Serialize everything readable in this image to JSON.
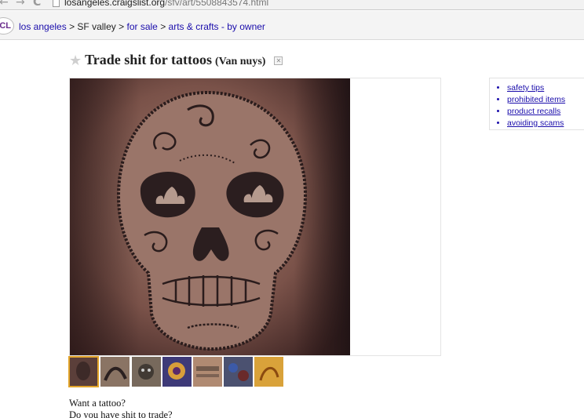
{
  "browser": {
    "url_host": "losangeles.craigslist.org",
    "url_path": "/sfv/art/5508843574.html",
    "back_glyph": "←",
    "forward_glyph": "→",
    "reload_glyph": "C"
  },
  "logo": {
    "text": "CL"
  },
  "breadcrumbs": {
    "items": [
      {
        "label": "los angeles",
        "link": true
      },
      {
        "label": "SF valley",
        "link": false
      },
      {
        "label": "for sale",
        "link": true
      },
      {
        "label": "arts & crafts - by owner",
        "link": true
      }
    ],
    "separator": ">"
  },
  "posting": {
    "title": "Trade shit for tattoos",
    "location": "(Van nuys)",
    "star_glyph": "★",
    "hide_glyph": "✕"
  },
  "gallery": {
    "selected_index": 0,
    "thumbnail_count": 7,
    "thumbnail_colors": [
      "#5b3f3a",
      "#8a7464",
      "#77695c",
      "#3e3a78",
      "#b08a72",
      "#4b5170",
      "#d9a23a"
    ]
  },
  "safety_links": [
    "safety tips",
    "prohibited items",
    "product recalls",
    "avoiding scams"
  ],
  "body": {
    "lines": [
      "Want a tattoo?",
      "Do you have shit to trade?"
    ]
  }
}
